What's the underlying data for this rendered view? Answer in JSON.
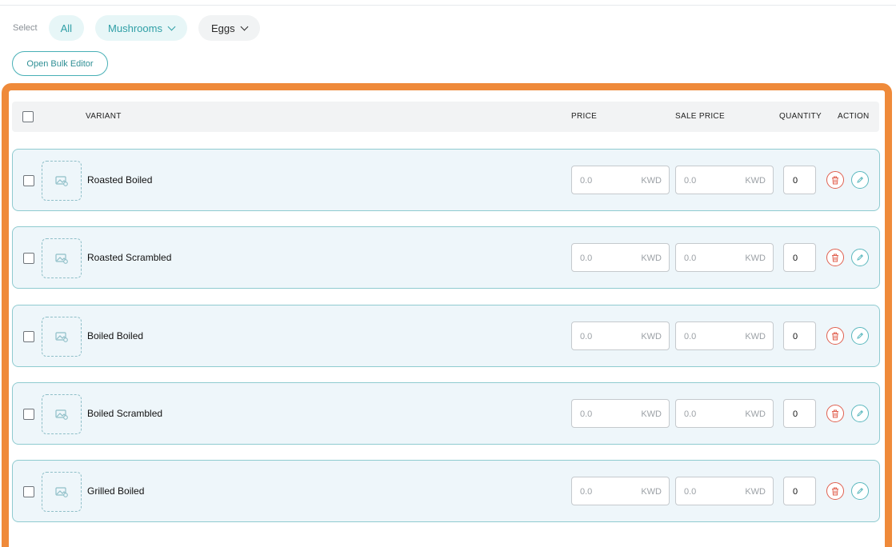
{
  "filters": {
    "label": "Select",
    "chips": [
      {
        "label": "All"
      },
      {
        "label": "Mushrooms"
      },
      {
        "label": "Eggs"
      }
    ]
  },
  "bulk_editor_label": "Open Bulk Editor",
  "table": {
    "headers": {
      "variant": "VARIANT",
      "price": "PRICE",
      "sale_price": "SALE PRICE",
      "quantity": "QUANTITY",
      "action": "ACTION"
    },
    "rows": [
      {
        "name": "Roasted Boiled",
        "price": "0.0",
        "price_currency": "KWD",
        "sale_price": "0.0",
        "sale_currency": "KWD",
        "quantity": "0"
      },
      {
        "name": "Roasted Scrambled",
        "price": "0.0",
        "price_currency": "KWD",
        "sale_price": "0.0",
        "sale_currency": "KWD",
        "quantity": "0"
      },
      {
        "name": "Boiled Boiled",
        "price": "0.0",
        "price_currency": "KWD",
        "sale_price": "0.0",
        "sale_currency": "KWD",
        "quantity": "0"
      },
      {
        "name": "Boiled Scrambled",
        "price": "0.0",
        "price_currency": "KWD",
        "sale_price": "0.0",
        "sale_currency": "KWD",
        "quantity": "0"
      },
      {
        "name": "Grilled Boiled",
        "price": "0.0",
        "price_currency": "KWD",
        "sale_price": "0.0",
        "sale_currency": "KWD",
        "quantity": "0"
      }
    ]
  },
  "colors": {
    "highlight_border": "#ef8a3a",
    "accent_teal": "#2f9fa6",
    "delete_red": "#e0604f",
    "row_background": "#eef6fa"
  },
  "icons": {
    "image_placeholder": "image-placeholder-icon",
    "delete": "trash-icon",
    "edit": "pencil-icon",
    "dropdown": "chevron-down-icon"
  }
}
